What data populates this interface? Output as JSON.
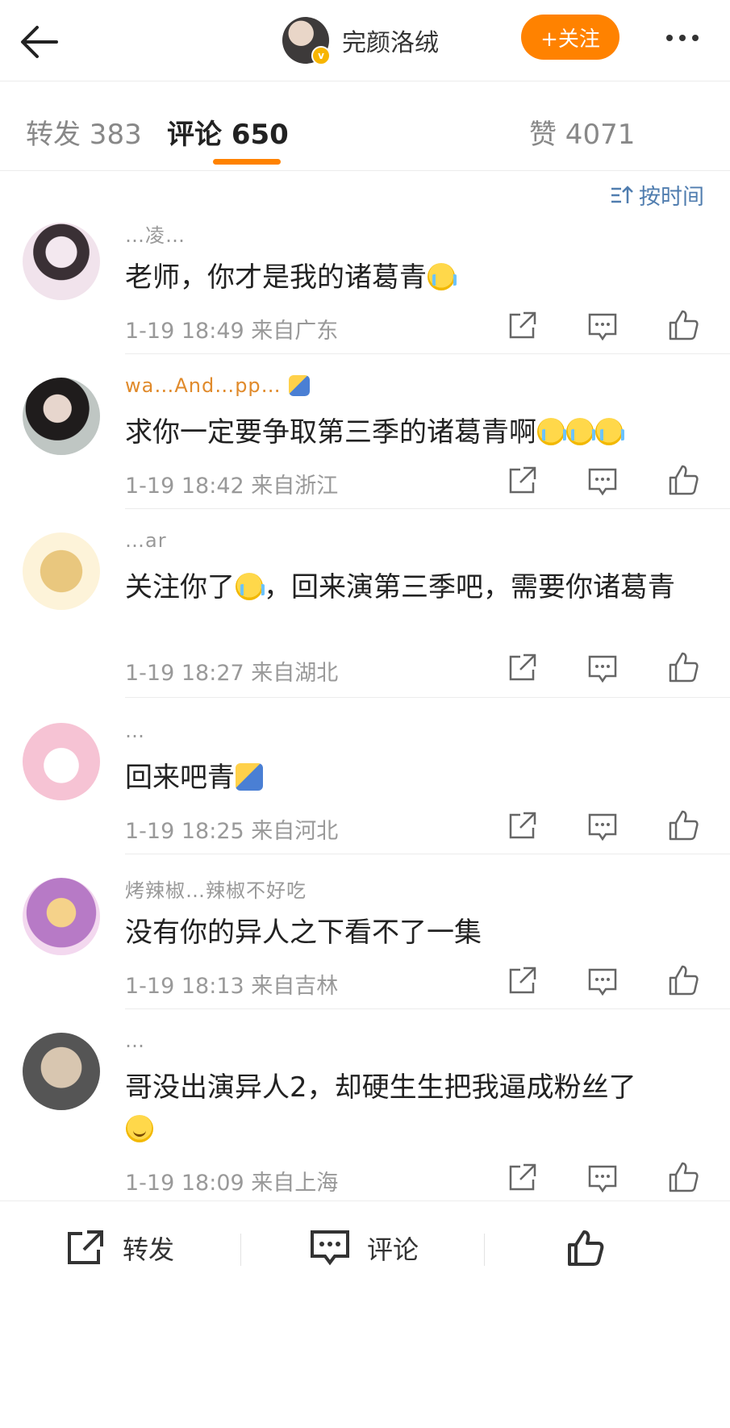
{
  "header": {
    "profile_name": "完颜洛绒",
    "follow_label": "+关注"
  },
  "tabs": {
    "repost": "转发 383",
    "comment": "评论 650",
    "like": "赞 4071"
  },
  "sort": {
    "label": "按时间"
  },
  "comments": [
    {
      "user": "…凌…",
      "text": "老师，你才是我的诸葛青",
      "emojis": [
        "cry"
      ],
      "time": "1-19 18:49",
      "location": "来自广东"
    },
    {
      "user": "wa…And…pp…",
      "text": "求你一定要争取第三季的诸葛青啊",
      "emojis": [
        "cry",
        "cry",
        "cry"
      ],
      "time": "1-19 18:42",
      "location": "来自浙江"
    },
    {
      "user": "…ar",
      "text": "关注你了",
      "text2": "，回来演第三季吧，需要你诸葛青",
      "emojis": [
        "cry"
      ],
      "time": "1-19 18:27",
      "location": "来自湖北"
    },
    {
      "user": "…",
      "text": "回来吧青",
      "emojis": [
        "sticker"
      ],
      "time": "1-19 18:25",
      "location": "来自河北"
    },
    {
      "user": "烤辣椒…辣椒不好吃",
      "text": "没有你的异人之下看不了一集",
      "emojis": [],
      "time": "1-19 18:13",
      "location": "来自吉林"
    },
    {
      "user": "…",
      "text": "哥没出演异人2，却硬生生把我逼成粉丝了",
      "emojis": [
        "smile"
      ],
      "time": "1-19 18:09",
      "location": "来自上海"
    }
  ],
  "bottom": {
    "repost": "转发",
    "comment": "评论"
  },
  "colors": {
    "accent": "#ff8200",
    "link": "#507daf"
  }
}
